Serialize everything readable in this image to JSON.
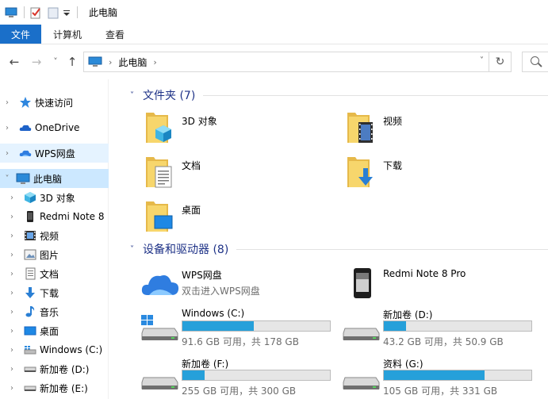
{
  "titlebar": {
    "title": "此电脑"
  },
  "ribbon": {
    "tabs": [
      "文件",
      "计算机",
      "查看"
    ]
  },
  "navbar": {
    "back": "←",
    "forward": "→",
    "recent": "˅",
    "up": "↑",
    "breadcrumb": [
      "此电脑"
    ],
    "chevron": "›",
    "dropdown": "˅",
    "refresh": "↻"
  },
  "sidebar": {
    "items": [
      {
        "label": "快速访问",
        "icon": "star-icon"
      },
      {
        "label": "OneDrive",
        "icon": "cloud-icon"
      },
      {
        "label": "WPS网盘",
        "icon": "wps-cloud-icon"
      },
      {
        "label": "此电脑",
        "icon": "computer-icon"
      },
      {
        "label": "3D 对象",
        "icon": "cube-icon"
      },
      {
        "label": "Redmi Note 8",
        "icon": "phone-icon"
      },
      {
        "label": "视频",
        "icon": "film-icon"
      },
      {
        "label": "图片",
        "icon": "picture-icon"
      },
      {
        "label": "文档",
        "icon": "document-icon"
      },
      {
        "label": "下载",
        "icon": "download-icon"
      },
      {
        "label": "音乐",
        "icon": "music-icon"
      },
      {
        "label": "桌面",
        "icon": "desktop-icon"
      },
      {
        "label": "Windows (C:)",
        "icon": "windows-drive-icon"
      },
      {
        "label": "新加卷 (D:)",
        "icon": "drive-icon"
      },
      {
        "label": "新加卷 (E:)",
        "icon": "drive-icon"
      }
    ]
  },
  "main": {
    "folders_group": {
      "title": "文件夹 (7)"
    },
    "folders": [
      {
        "label": "3D 对象",
        "icon": "cube-folder-icon"
      },
      {
        "label": "视频",
        "icon": "video-folder-icon"
      },
      {
        "label": "文档",
        "icon": "document-folder-icon"
      },
      {
        "label": "下载",
        "icon": "download-folder-icon"
      },
      {
        "label": "桌面",
        "icon": "desktop-folder-icon"
      }
    ],
    "devices_group": {
      "title": "设备和驱动器 (8)"
    },
    "devices": [
      {
        "name": "WPS网盘",
        "subtitle": "双击进入WPS网盘",
        "icon": "wps-cloud-icon"
      },
      {
        "name": "Redmi Note 8 Pro",
        "icon": "phone-device-icon"
      }
    ],
    "drives": [
      {
        "name": "Windows (C:)",
        "size": "91.6 GB 可用，共 178 GB",
        "used_fraction": 0.485,
        "icon": "windows-drive-icon"
      },
      {
        "name": "新加卷 (D:)",
        "size": "43.2 GB 可用，共 50.9 GB",
        "used_fraction": 0.151,
        "icon": "drive-icon"
      },
      {
        "name": "新加卷 (F:)",
        "size": "255 GB 可用，共 300 GB",
        "used_fraction": 0.15,
        "icon": "drive-icon"
      },
      {
        "name": "资料 (G:)",
        "size": "105 GB 可用，共 331 GB",
        "used_fraction": 0.683,
        "icon": "drive-icon"
      }
    ]
  },
  "colors": {
    "accent": "#1a6fc9",
    "group_header": "#1e3287",
    "drive_fill": "#26a0da",
    "selected": "#cce8ff",
    "hover": "#e5f3ff"
  }
}
